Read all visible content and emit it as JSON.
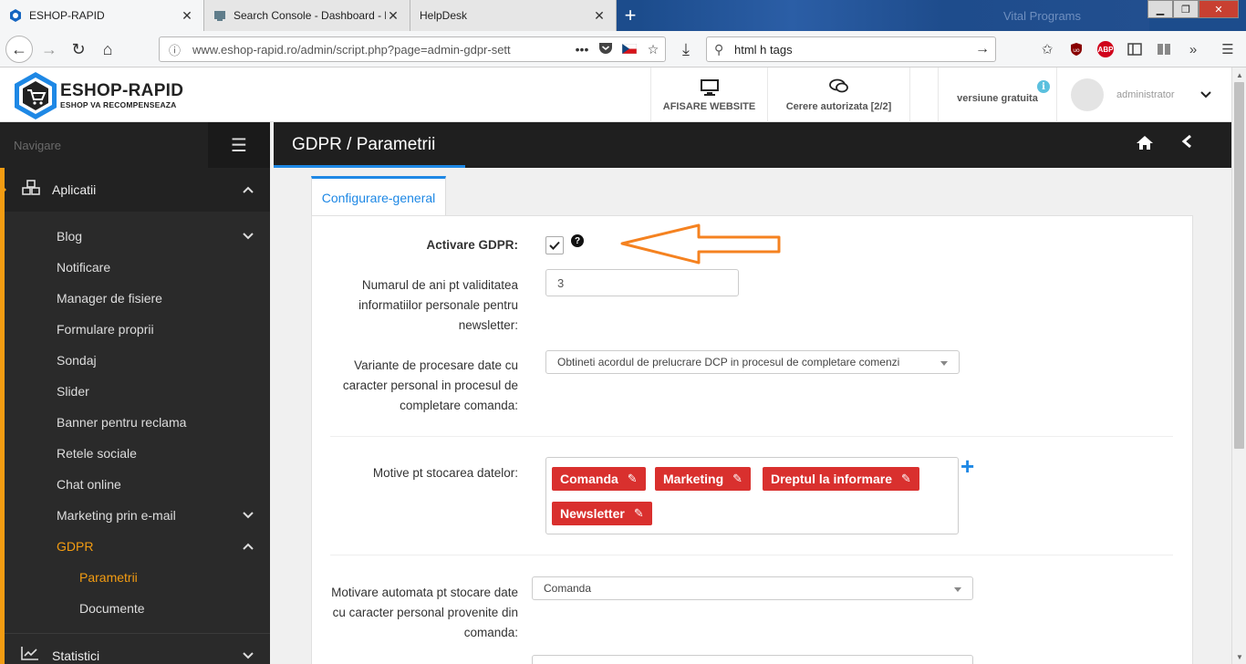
{
  "browser": {
    "tabs": [
      {
        "title": "ESHOP-RAPID",
        "active": true
      },
      {
        "title": "Search Console - Dashboard - h",
        "active": false
      },
      {
        "title": "HelpDesk",
        "active": false
      }
    ],
    "background_text": "Vital Programs",
    "url": "www.eshop-rapid.ro/admin/script.php?page=admin-gdpr-sett",
    "search_text": "html h tags"
  },
  "header": {
    "logo_name": "ESHOP-RAPID",
    "logo_tagline": "ESHOP VA RECOMPENSEAZA",
    "view_site_label": "AFISARE WEBSITE",
    "auth_requests_label": "Cerere autorizata [2/2]",
    "version_label": "versiune gratuita",
    "username": "administrator"
  },
  "sidebar": {
    "title": "Navigare",
    "sections": {
      "apps": "Aplicatii",
      "stats": "Statistici"
    },
    "items": [
      {
        "label": "Blog",
        "has_children": true
      },
      {
        "label": "Notificare"
      },
      {
        "label": "Manager de fisiere"
      },
      {
        "label": "Formulare proprii"
      },
      {
        "label": "Sondaj"
      },
      {
        "label": "Slider"
      },
      {
        "label": "Banner pentru reclama"
      },
      {
        "label": "Retele sociale"
      },
      {
        "label": "Chat online"
      },
      {
        "label": "Marketing prin e-mail",
        "has_children": true
      },
      {
        "label": "GDPR",
        "has_children": true,
        "active": true
      }
    ],
    "gdpr_children": [
      "Parametrii",
      "Documente"
    ]
  },
  "content": {
    "title": "GDPR / Parametrii",
    "tab_label": "Configurare-general",
    "form": {
      "activate_label": "Activare GDPR:",
      "activate_checked": true,
      "years_label": [
        "Numarul de ani pt validitatea",
        "informatiilor personale pentru",
        "newsletter:"
      ],
      "years_value": "3",
      "processing_label": [
        "Variante de procesare date cu",
        "caracter personal in procesul de",
        "completare comanda:"
      ],
      "processing_value": "Obtineti acordul de prelucrare DCP in procesul de completare comenzi",
      "reasons_label": "Motive pt stocarea datelor:",
      "reasons": [
        "Comanda",
        "Marketing",
        "Dreptul la informare",
        "Newsletter"
      ],
      "auto_reason_label": [
        "Motivare automata pt stocare date",
        "cu caracter personal provenite din",
        "comanda:"
      ],
      "auto_reason_value": "Comanda"
    }
  },
  "colors": {
    "accent_orange": "#f39c12",
    "primary_blue": "#1e88e5",
    "tag_red": "#d9302e",
    "sidebar_bg": "#2a2a2a",
    "annotation_arrow": "#f58220"
  }
}
